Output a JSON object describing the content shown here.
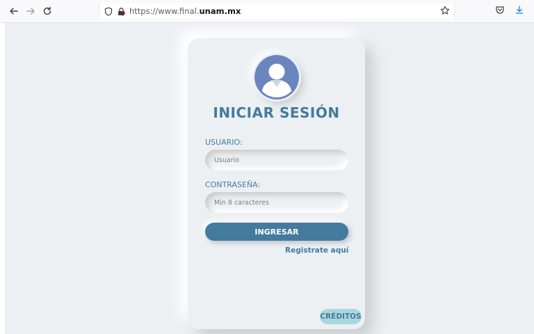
{
  "browser": {
    "back_icon": "arrow-left-icon",
    "forward_icon": "arrow-right-icon",
    "reload_icon": "reload-icon",
    "url_prefix": "https://www.final.",
    "url_domain": "unam.mx",
    "colors": {
      "toolbar_bg": "#f9f9fb",
      "text": "#15141a"
    }
  },
  "login": {
    "title": "INICIAR SESIÓN",
    "user_label": "USUARIO:",
    "user_placeholder": "Usuario",
    "password_label": "CONTRASEÑA:",
    "password_placeholder": "Min 8 caracteres",
    "submit_label": "INGRESAR",
    "register_link": "Registrate aquí",
    "credits_label": "CRÉDITOS",
    "colors": {
      "accent": "#447a9e",
      "background": "#ecf0f3",
      "avatar": "#6b86be",
      "credits_bg": "#a8d8dc"
    }
  }
}
